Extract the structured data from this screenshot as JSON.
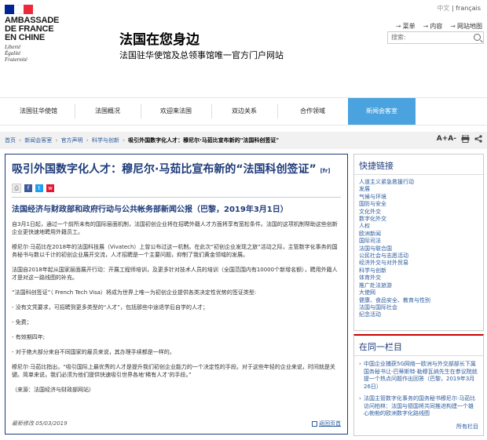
{
  "logo": {
    "flag_colors": [
      "#002395",
      "#ffffff",
      "#ed2939"
    ],
    "line1": "AMBASSADE",
    "line2": "DE FRANCE",
    "line3": "EN CHINE",
    "motto1": "Liberté",
    "motto2": "Égalité",
    "motto3": "Fraternité"
  },
  "header": {
    "title": "法国在您身边",
    "subtitle": "法国驻华使馆及总领事馆唯一官方门户网站",
    "lang_zh": "中文",
    "lang_sep": "|",
    "lang_fr": "français",
    "link_menu": "菜单",
    "link_content": "内容",
    "link_sitemap": "网站地图",
    "search_placeholder": "搜索:",
    "search_icon": "search-icon"
  },
  "nav": {
    "items": [
      {
        "label": "法国驻华使馆"
      },
      {
        "label": "法国概况"
      },
      {
        "label": "欢迎来法国"
      },
      {
        "label": "双边关系"
      },
      {
        "label": "合作领域"
      },
      {
        "label": "新闻会客室"
      }
    ],
    "active_color": "#4aa3df"
  },
  "breadcrumb": {
    "items": [
      "首页",
      "新闻会客室",
      "官方声明",
      "科学与创新"
    ],
    "current": "吸引外国数字化人才：穆尼尔·马茹比宣布新的\"法国科创签证\"",
    "sep": "›",
    "font_tool": "A+A-",
    "print_tool": "print-icon",
    "share_tool": "share-icon"
  },
  "article": {
    "title": "吸引外国数字化人才：穆尼尔·马茹比宣布新的“法国科创签证”",
    "fr_link": "[fr]",
    "lead": "法国经济与财政部和政府行动与公共帐务部新闻公报（巴黎，2019年3月1日）",
    "paragraphs": [
      "自3月1日起，通过一个前所未有的国际层面机制，法国初创企业将在招聘外籍人才方面将享有宽松条件。法国的这项机制帮助这些创新企业更快速地聘用外籍员工。",
      "穆尼尔·马茹比在2018年的法国科技展（Vivatech）上曾公布过这一机制。在此次“初创企业发现之旅”活动之际，主管数字化事务的国务秘书与数以千计的初创企业展开交流，人才招聘是一个主要问题，抑制了我们黄金领域的发展。",
      "法国自2018年起从国家层面展开行动：开展工程师培训，及更多针对技术人员的培训（全国范围内有10000个新增名额），聘用外籍人才是对这一路线图的补充。",
      "“法国科创签证”（ French Tech Visa）将成为世界上唯一为初创企业提供各类决定性优势的签证类型:",
      "- 没有文凭要求，可招聘到更多类型的“人才”，包括那些中途退学后自学的人才；",
      "- 免费；",
      "- 有效期四年;",
      "- 对于绝大部分来自不同国家的雇员来说，其办理手续都是一样的。",
      "穆尼尔·马茹比指出，“吸引国际上最优秀的人才是提升我们初创企业能力的一个决定性的手段。对于这些年轻的企业来说，时间就是关键。简单来说，我们必须为他们提供快速吸引世界各地‘稀有人才’的手段。”",
      "（来源：法国经济与财政部网站）"
    ],
    "modified": "最新修改 05/03/2019",
    "back_label": "返回页首",
    "share_icons": [
      "print-icon",
      "facebook-icon",
      "twitter-icon",
      "weibo-icon"
    ]
  },
  "quicklinks": {
    "title": "快捷链接",
    "items": [
      "人道主义紧急救援行动",
      "发展",
      "气候与环境",
      "国防与安全",
      "文化外交",
      "数字化外交",
      "人权",
      "欧洲新闻",
      "国际司法",
      "法国与联合国",
      "公民社会与志愿活动",
      "经济外交与对外贸易",
      "科学与创新",
      "体育外交",
      "推广赴法旅游",
      "大使网",
      "健康、食品安全、教育与性别",
      "法国与国际社会",
      "纪念活动"
    ]
  },
  "same_column": {
    "title": "在同一栏目",
    "items": [
      "中国企业捕获5G网络一欧洲与外交部部长下属国务秘书让-巴蒂斯特·勒穆瓦纳先生在参议院就提一个热点问题作出回答（巴黎，2019年3月26日）",
      "法国主管数字化事务的国务秘书穆尼尔·马茹比访问柏林：法国与德国将共同推进构建一个雄心勃勃的欧洲数字化路线图"
    ],
    "all_label": "所有栏目"
  }
}
